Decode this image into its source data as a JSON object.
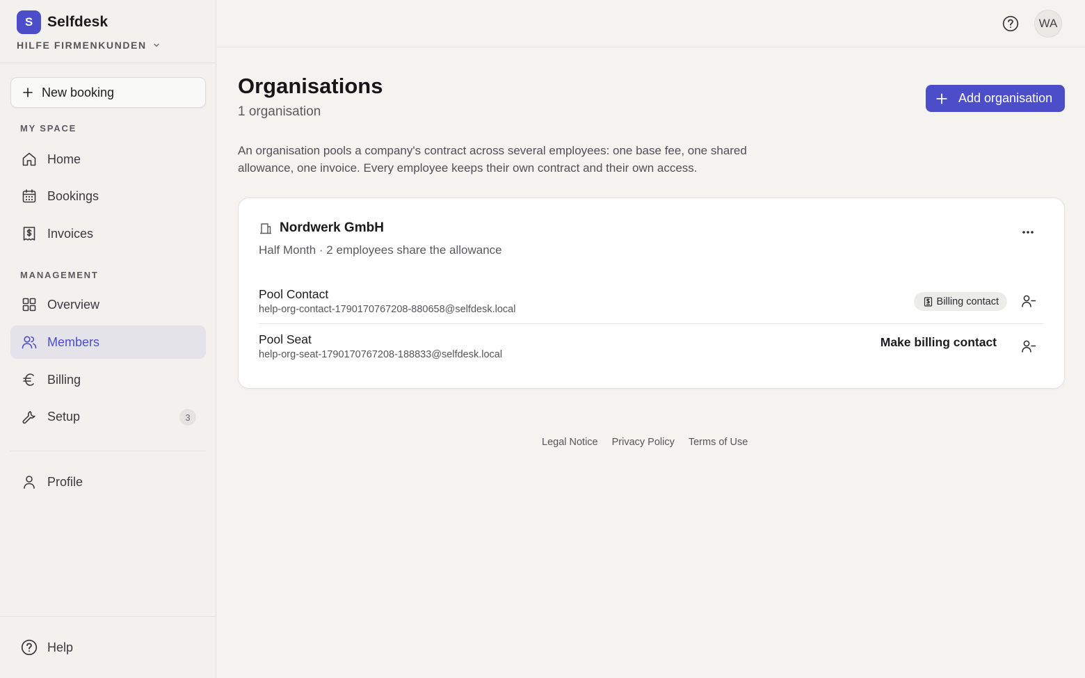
{
  "app": {
    "logo_letter": "S",
    "name": "Selfdesk",
    "workspace": "HILFE FIRMENKUNDEN"
  },
  "sidebar": {
    "new_booking_label": "New booking",
    "my_space_label": "MY SPACE",
    "management_label": "MANAGEMENT",
    "my_space_items": [
      {
        "label": "Home",
        "icon": "home-icon"
      },
      {
        "label": "Bookings",
        "icon": "calendar-icon"
      },
      {
        "label": "Invoices",
        "icon": "invoice-icon"
      }
    ],
    "management_items": [
      {
        "label": "Overview",
        "icon": "grid-icon"
      },
      {
        "label": "Members",
        "icon": "users-icon",
        "active": true
      },
      {
        "label": "Billing",
        "icon": "euro-icon"
      },
      {
        "label": "Setup",
        "icon": "wrench-icon",
        "badge": "3"
      }
    ],
    "profile_label": "Profile",
    "help_label": "Help"
  },
  "topbar": {
    "avatar_initials": "WA"
  },
  "main": {
    "title": "Organisations",
    "subtitle": "1 organisation",
    "add_button_label": "Add organisation",
    "intro": "An organisation pools a company's contract across several employees: one base fee, one shared allowance, one invoice. Every employee keeps their own contract and their own access."
  },
  "organisation": {
    "name": "Nordwerk GmbH",
    "meta": "Half Month · 2 employees share the allowance",
    "members": [
      {
        "name": "Pool Contact",
        "email": "help-org-contact-1790170767208-880658@selfdesk.local",
        "badge": "Billing contact"
      },
      {
        "name": "Pool Seat",
        "email": "help-org-seat-1790170767208-188833@selfdesk.local",
        "action": "Make billing contact"
      }
    ]
  },
  "footer": {
    "links": [
      "Legal Notice",
      "Privacy Policy",
      "Terms of Use"
    ]
  },
  "colors": {
    "accent": "#4b4ec8",
    "background": "#f4f3f0",
    "active_nav_bg": "#e4e3ea"
  }
}
